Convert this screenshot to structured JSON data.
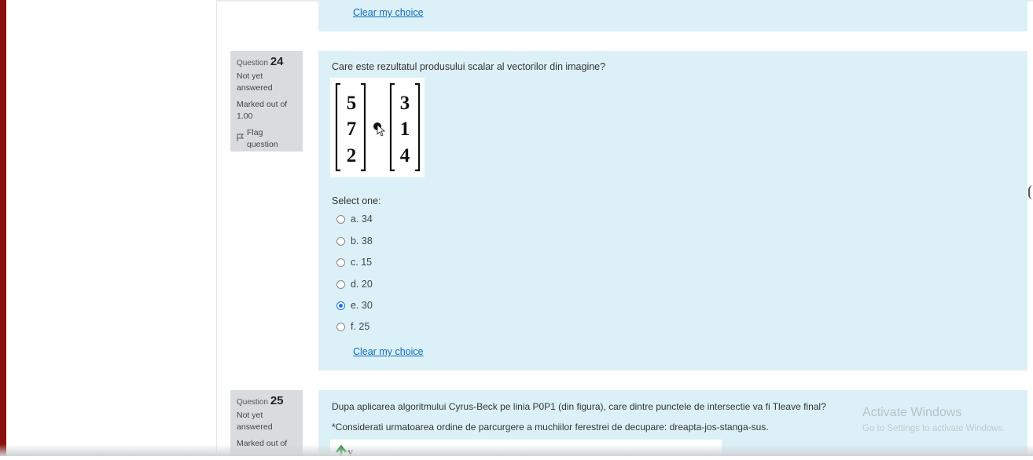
{
  "previous_question": {
    "clear_label": "Clear my choice"
  },
  "question24": {
    "number_prefix": "Question",
    "number": "24",
    "state_line1": "Not yet",
    "state_line2": "answered",
    "marks_line1": "Marked out of",
    "marks_line2": "1.00",
    "flag_label": "Flag question",
    "text": "Care este rezultatul produsului scalar al vectorilor din imagine?",
    "vector_a": [
      "5",
      "7",
      "2"
    ],
    "vector_b": [
      "3",
      "1",
      "4"
    ],
    "prompt": "Select one:",
    "options": [
      {
        "label": "a. 34",
        "selected": false
      },
      {
        "label": "b. 38",
        "selected": false
      },
      {
        "label": "c. 15",
        "selected": false
      },
      {
        "label": "d. 20",
        "selected": false
      },
      {
        "label": "e. 30",
        "selected": true
      },
      {
        "label": "f. 25",
        "selected": false
      }
    ],
    "clear_label": "Clear my choice"
  },
  "question25": {
    "number_prefix": "Question",
    "number": "25",
    "state_line1": "Not yet",
    "state_line2": "answered",
    "marks_line1": "Marked out of",
    "text": "Dupa aplicarea algoritmului Cyrus-Beck pe linia P0P1 (din figura), care dintre punctele de intersectie va fi Tleave final?",
    "note": "*Considerati urmatoarea ordine de parcurgere a muchiilor ferestrei de decupare: dreapta-jos-stanga-sus.",
    "figure_label": "y"
  },
  "watermark": {
    "title": "Activate Windows",
    "subtitle": "Go to Settings to activate Windows."
  },
  "colors": {
    "card": "#dcf1f7",
    "info": "#d9dcde",
    "link": "#0f6cbf",
    "radio_selected": "#1a73e8",
    "left_edge": "#8b1010"
  }
}
